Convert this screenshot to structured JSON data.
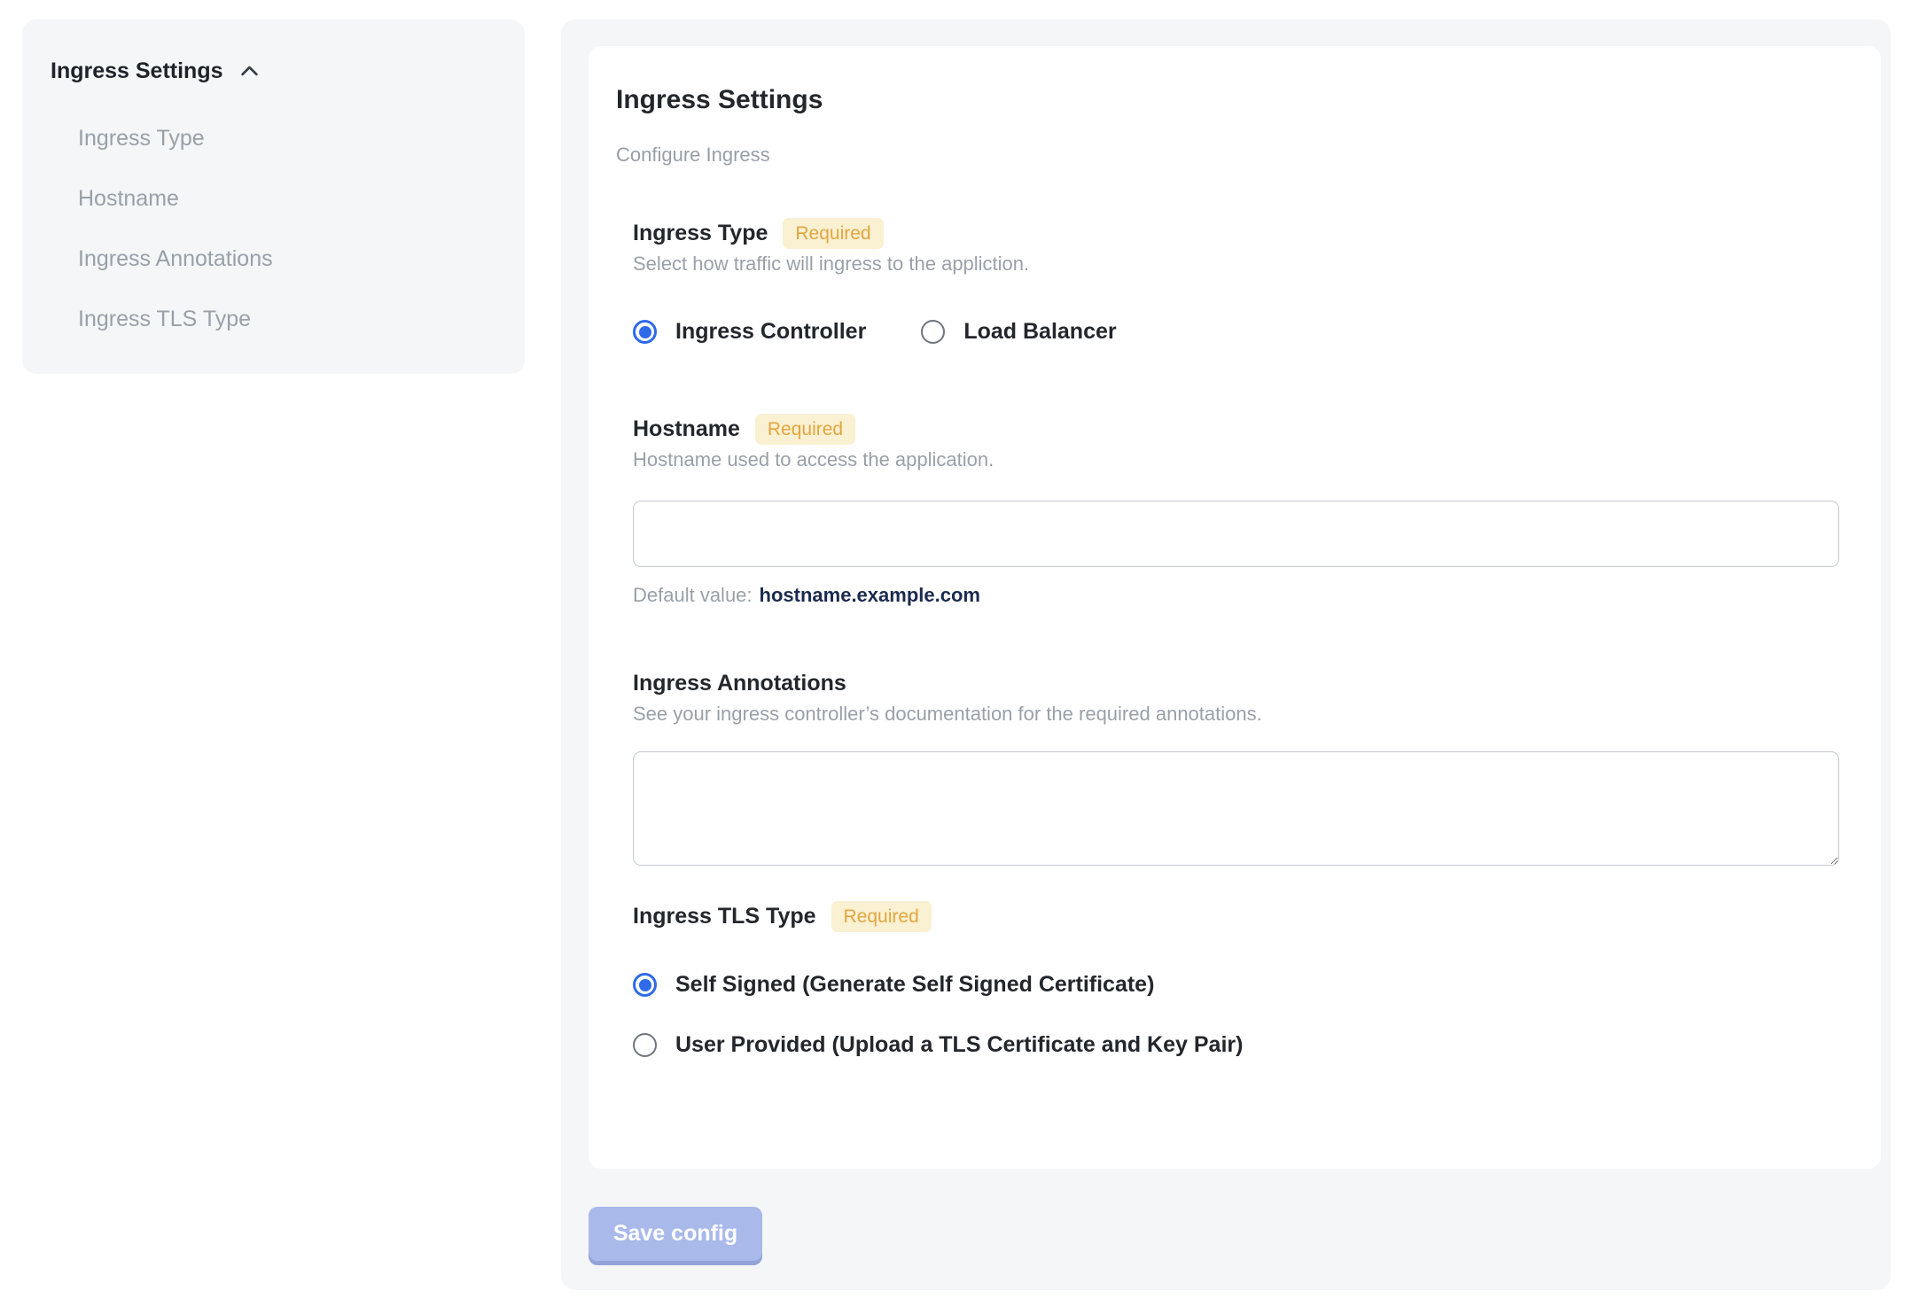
{
  "sidebar": {
    "header": "Ingress Settings",
    "items": [
      {
        "label": "Ingress Type"
      },
      {
        "label": "Hostname"
      },
      {
        "label": "Ingress Annotations"
      },
      {
        "label": "Ingress TLS Type"
      }
    ]
  },
  "panel": {
    "title": "Ingress Settings",
    "subtitle": "Configure Ingress",
    "badge_required": "Required",
    "ingress_type": {
      "label": "Ingress Type",
      "help": "Select how traffic will ingress to the appliction.",
      "options": [
        {
          "label": "Ingress Controller",
          "selected": true
        },
        {
          "label": "Load Balancer",
          "selected": false
        }
      ]
    },
    "hostname": {
      "label": "Hostname",
      "help": "Hostname used to access the application.",
      "value": "",
      "default_prefix": "Default value:",
      "default_value": "hostname.example.com"
    },
    "annotations": {
      "label": "Ingress Annotations",
      "help": "See your ingress controller’s documentation for the required annotations.",
      "value": ""
    },
    "tls": {
      "label": "Ingress TLS Type",
      "options": [
        {
          "label": "Self Signed (Generate Self Signed Certificate)",
          "selected": true
        },
        {
          "label": "User Provided (Upload a TLS Certificate and Key Pair)",
          "selected": false
        }
      ]
    },
    "save_button": "Save config"
  },
  "colors": {
    "accent_blue": "#2e6be8",
    "badge_bg": "#faf0d2",
    "badge_text": "#e2a63e",
    "panel_bg": "#f4f6f8",
    "default_value_navy": "#1b2a4e",
    "save_button_bg": "#a9b9ea",
    "save_button_shadow": "#93a3d8"
  }
}
